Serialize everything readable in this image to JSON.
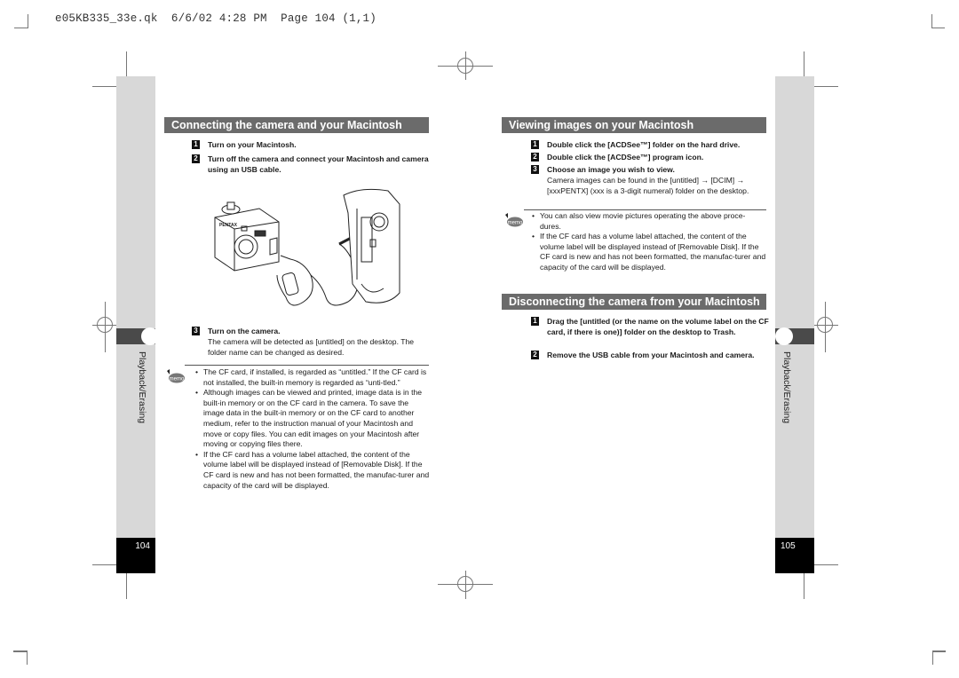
{
  "slug": "e05KB335_33e.qk  6/6/02 4:28 PM  Page 104 (1,1)",
  "left_page": {
    "section_title": "Connecting the camera and your Macintosh",
    "steps": [
      {
        "num": "1",
        "title": "Turn on your Macintosh.",
        "body": ""
      },
      {
        "num": "2",
        "title": "Turn off the camera and connect your Macintosh and camera using an USB cable.",
        "body": ""
      },
      {
        "num": "3",
        "title": "Turn on the camera.",
        "body": "The camera will be detected as [untitled] on the desktop. The folder name can be changed as desired."
      }
    ],
    "memo_label": "memo",
    "memo_bullets": [
      "The CF card, if installed, is regarded as “untitled.” If the CF card is not installed, the built-in memory is regarded as “unti-tled.”",
      "Although images can be viewed and printed, image data is in the built-in memory or on the CF card in the camera. To save the image data in the built-in memory or on the CF card to another medium, refer to the instruction manual of your Macintosh and move or copy files. You can edit images on your Macintosh after moving or copying files there.",
      "If the CF card has a volume label attached, the content of the volume label will be displayed instead of [Removable Disk]. If the CF card is new and has not been formatted, the manufac-turer and capacity of the card will be displayed."
    ],
    "illustration": "camera-usb-connection",
    "camera_brand": "PENTAX",
    "side_tab_label": "Playback/Erasing",
    "page_number": "104"
  },
  "right_page": {
    "section1_title": "Viewing images on your Macintosh",
    "section1_steps": [
      {
        "num": "1",
        "title": "Double click the [ACDSee™] folder on the hard drive.",
        "body": ""
      },
      {
        "num": "2",
        "title": "Double click the [ACDSee™] program icon.",
        "body": ""
      },
      {
        "num": "3",
        "title": "Choose an image you wish to view.",
        "body": "Camera images can be found in the [untitled] → [DCIM] → [xxxPENTX] (xxx is a 3-digit numeral) folder on the desktop."
      }
    ],
    "memo_label": "memo",
    "memo_bullets": [
      "You can also view movie pictures operating the above proce-dures.",
      "If the CF card has a volume label attached, the content of the volume label will be displayed instead of [Removable Disk]. If the CF card is new and has not been formatted, the manufac-turer and capacity of the card will be displayed."
    ],
    "section2_title": "Disconnecting the camera from your Macintosh",
    "section2_steps": [
      {
        "num": "1",
        "title": "Drag the [untitled (or the name on the volume label on the CF card, if there is one)] folder on the desktop to Trash.",
        "body": ""
      },
      {
        "num": "2",
        "title": "Remove the USB cable from your Macintosh and camera.",
        "body": ""
      }
    ],
    "side_tab_label": "Playback/Erasing",
    "page_number": "105"
  }
}
